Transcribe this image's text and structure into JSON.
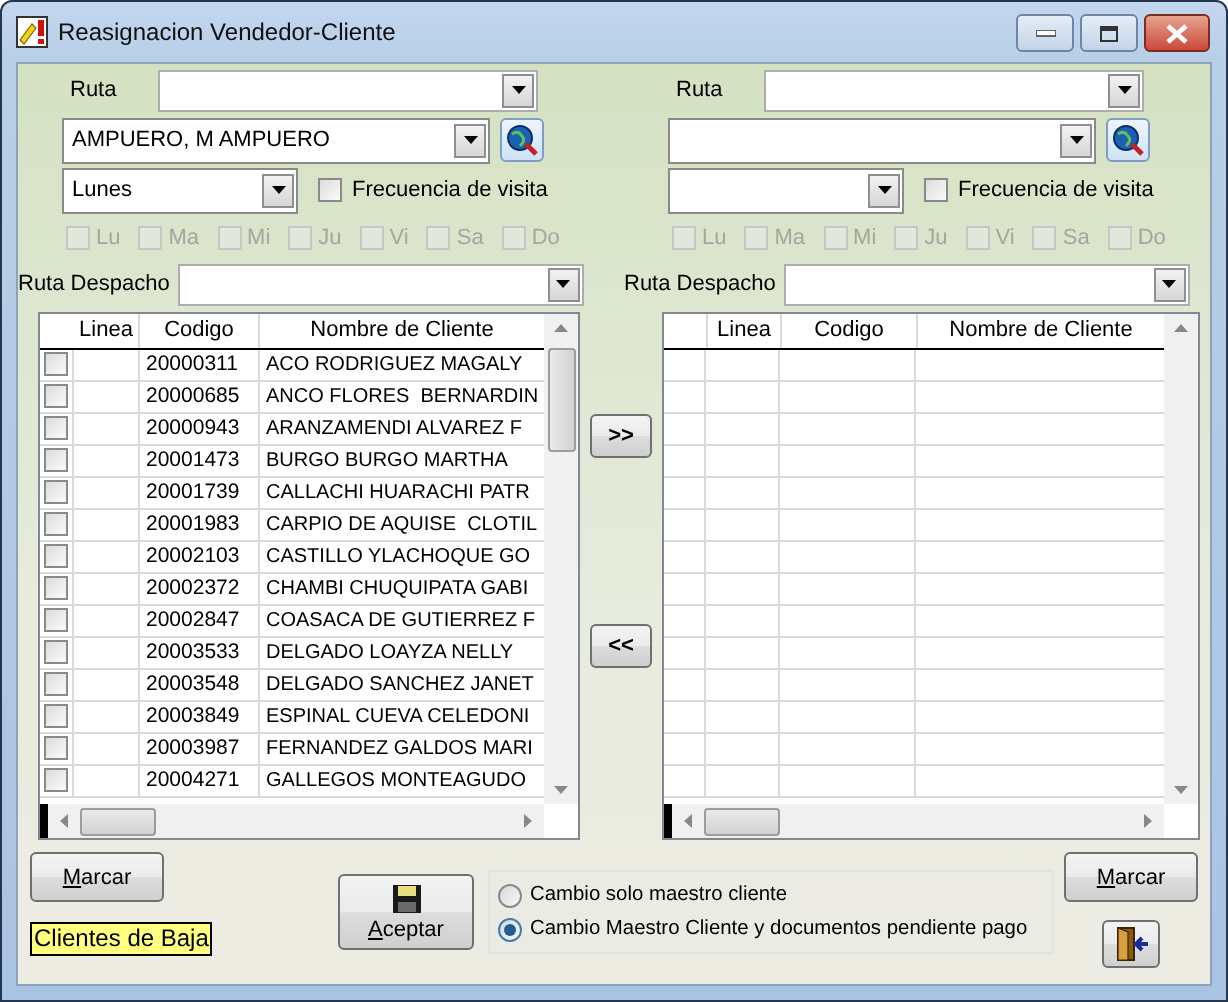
{
  "window": {
    "title": "Reasignacion  Vendedor-Cliente"
  },
  "panels": [
    {
      "ruta": {
        "label": "Ruta"
      },
      "vendedor": {
        "value": "AMPUERO, M AMPUERO"
      },
      "dia": {
        "value": "Lunes"
      },
      "frecuencia": {
        "label": "Frecuencia de visita",
        "checked": false
      },
      "days": [
        {
          "label": "Lu",
          "checked": false,
          "disabled": true
        },
        {
          "label": "Ma",
          "checked": false,
          "disabled": true
        },
        {
          "label": "Mi",
          "checked": false,
          "disabled": true
        },
        {
          "label": "Ju",
          "checked": false,
          "disabled": true
        },
        {
          "label": "Vi",
          "checked": false,
          "disabled": true
        },
        {
          "label": "Sa",
          "checked": false,
          "disabled": true
        },
        {
          "label": "Do",
          "checked": false,
          "disabled": true
        }
      ],
      "ruta_despacho": {
        "label": "Ruta Despacho"
      },
      "table": {
        "columns": [
          "Linea",
          "Codigo",
          "Nombre de Cliente"
        ],
        "rows": [
          {
            "checked": false,
            "codigo": "20000311",
            "nombre": "ACO RODRIGUEZ MAGALY"
          },
          {
            "checked": false,
            "codigo": "20000685",
            "nombre": "ANCO FLORES  BERNARDIN"
          },
          {
            "checked": false,
            "codigo": "20000943",
            "nombre": "ARANZAMENDI ALVAREZ F"
          },
          {
            "checked": false,
            "codigo": "20001473",
            "nombre": "BURGO BURGO MARTHA"
          },
          {
            "checked": false,
            "codigo": "20001739",
            "nombre": "CALLACHI HUARACHI PATR"
          },
          {
            "checked": false,
            "codigo": "20001983",
            "nombre": "CARPIO DE AQUISE  CLOTIL"
          },
          {
            "checked": false,
            "codigo": "20002103",
            "nombre": "CASTILLO YLACHOQUE GO"
          },
          {
            "checked": false,
            "codigo": "20002372",
            "nombre": "CHAMBI CHUQUIPATA GABI"
          },
          {
            "checked": false,
            "codigo": "20002847",
            "nombre": "COASACA DE GUTIERREZ F"
          },
          {
            "checked": false,
            "codigo": "20003533",
            "nombre": "DELGADO LOAYZA NELLY"
          },
          {
            "checked": false,
            "codigo": "20003548",
            "nombre": "DELGADO SANCHEZ JANET"
          },
          {
            "checked": false,
            "codigo": "20003849",
            "nombre": "ESPINAL CUEVA CELEDONI"
          },
          {
            "checked": false,
            "codigo": "20003987",
            "nombre": "FERNANDEZ GALDOS MARI"
          },
          {
            "checked": false,
            "codigo": "20004271",
            "nombre": "GALLEGOS MONTEAGUDO"
          }
        ]
      },
      "mark_button": "Marcar"
    },
    {
      "ruta": {
        "label": "Ruta"
      },
      "frecuencia": {
        "label": "Frecuencia de visita",
        "checked": false
      },
      "days": [
        {
          "label": "Lu",
          "checked": false,
          "disabled": true
        },
        {
          "label": "Ma",
          "checked": false,
          "disabled": true
        },
        {
          "label": "Mi",
          "checked": false,
          "disabled": true
        },
        {
          "label": "Ju",
          "checked": false,
          "disabled": true
        },
        {
          "label": "Vi",
          "checked": false,
          "disabled": true
        },
        {
          "label": "Sa",
          "checked": false,
          "disabled": true
        },
        {
          "label": "Do",
          "checked": false,
          "disabled": true
        }
      ],
      "ruta_despacho": {
        "label": "Ruta Despacho"
      },
      "table": {
        "columns": [
          "Linea",
          "Codigo",
          "Nombre de Cliente"
        ]
      },
      "mark_button": "Marcar"
    }
  ],
  "transfer_buttons": [
    ">>",
    "<<"
  ],
  "accept_button": "Aceptar",
  "options": [
    {
      "label": "Cambio solo maestro cliente",
      "selected": false
    },
    {
      "label": "Cambio Maestro Cliente y documentos pendiente pago",
      "selected": true
    }
  ],
  "status_label": "Clientes de Baja"
}
